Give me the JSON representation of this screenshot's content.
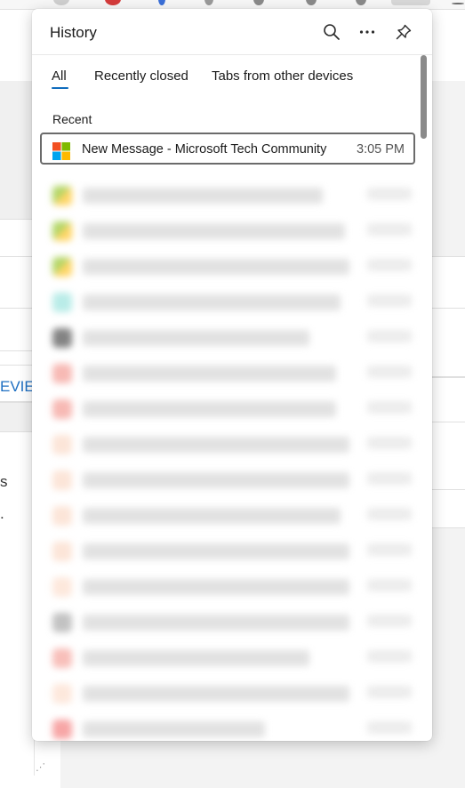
{
  "background": {
    "link_fragment": "EVIE",
    "text_fragment_1": "s",
    "text_fragment_2": "."
  },
  "flyout": {
    "title": "History",
    "search_icon": "search-icon",
    "more_icon": "more-horizontal-icon",
    "pin_icon": "pin-icon",
    "tabs": [
      {
        "label": "All",
        "selected": true
      },
      {
        "label": "Recently closed",
        "selected": false
      },
      {
        "label": "Tabs from other devices",
        "selected": false
      }
    ],
    "section_label": "Recent",
    "selected_entry": {
      "title": "New Message - Microsoft Tech Community",
      "time": "3:05 PM",
      "favicon": "microsoft-logo-icon"
    }
  },
  "colors": {
    "accent": "#0f6cbd",
    "selected_border": "#6b6b6b",
    "ms_red": "#f25022",
    "ms_green": "#7fba00",
    "ms_blue": "#00a4ef",
    "ms_yellow": "#ffb900"
  }
}
